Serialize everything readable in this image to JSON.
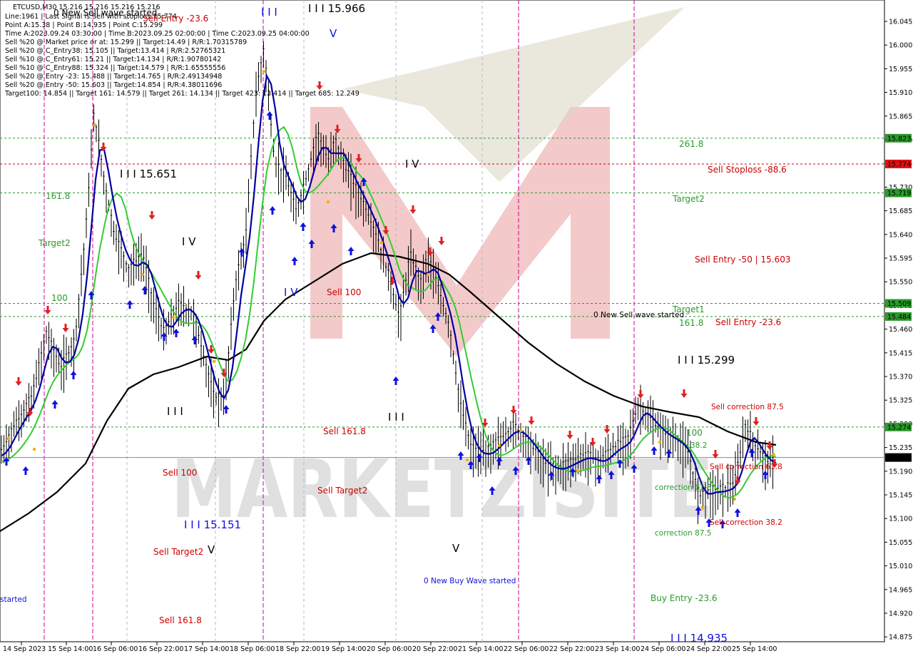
{
  "info": {
    "symbol_line": "ETCUSD,M30  15.216 15.216 15.216 15.216",
    "lines": [
      "Line:1961 | Last Signal is:Sell with stoploss:15.774",
      "Point A:15.38 | Point B:14.935 | Point C:15.299",
      "Time A:2023.09.24 03:30:00 | Time B:2023.09.25 02:00:00 | Time C:2023.09.25 04:00:00",
      "Sell %20 @ Market price or at: 15.299 || Target:14.49 | R/R:1.70315789",
      "Sell %20 @ C_Entry38: 15.105 || Target:13.414 | R/R:2.52765321",
      "Sell %10 @ C_Entry61: 15.21 || Target:14.134 | R/R:1.90780142",
      "Sell %10 @ C_Entry88: 15.324 || Target:14.579 | R/R:1.65555556",
      "Sell %20 @ Entry -23: 15.488 || Target:14.765 | R/R:2.49134948",
      "Sell %20 @ Entry -50: 15.603 || Target:14.854 | R/R:4.38011696",
      "Target100: 14.854 || Target 161: 14.579 || Target 261: 14.134 || Target 423: 13.414 || Target 685: 12.249"
    ]
  },
  "watermark": "MARKETZISITE",
  "colors": {
    "background": "#ffffff",
    "sell_red": "#e02020",
    "buy_blue": "#1010e0",
    "green_line": "#33cc33",
    "navy_line": "#0000a0",
    "black_line": "#000000",
    "level_green": "#2a9a2a",
    "level_red": "#cc0000",
    "current_price_line": "#7a8aa8"
  },
  "price_axis": {
    "ticks": [
      "16.045",
      "16.000",
      "15.955",
      "15.910",
      "15.865",
      "15.820",
      "15.775",
      "15.730",
      "15.685",
      "15.640",
      "15.595",
      "15.550",
      "15.505",
      "15.460",
      "15.415",
      "15.370",
      "15.325",
      "15.280",
      "15.235",
      "15.190",
      "15.145",
      "15.100",
      "15.055",
      "15.010",
      "14.965",
      "14.920",
      "14.875"
    ],
    "tag_labels": [
      {
        "text": "15.823",
        "kind": "green"
      },
      {
        "text": "15.774",
        "kind": "red"
      },
      {
        "text": "15.719",
        "kind": "green"
      },
      {
        "text": "15.509",
        "kind": "green"
      },
      {
        "text": "15.484",
        "kind": "green"
      },
      {
        "text": "15.274",
        "kind": "green"
      },
      {
        "text": "15.216",
        "kind": "current"
      }
    ]
  },
  "time_axis": {
    "labels": [
      "14 Sep 2023",
      "15 Sep 14:00",
      "16 Sep 06:00",
      "16 Sep 22:00",
      "17 Sep 14:00",
      "18 Sep 06:00",
      "18 Sep 22:00",
      "19 Sep 14:00",
      "20 Sep 06:00",
      "20 Sep 22:00",
      "21 Sep 14:00",
      "22 Sep 06:00",
      "22 Sep 22:00",
      "23 Sep 14:00",
      "24 Sep 06:00",
      "24 Sep 22:00",
      "25 Sep 14:00"
    ]
  },
  "annotations": [
    {
      "text": "0 New Sell wave started",
      "color": "black"
    },
    {
      "text": "Sell Entry -23.6",
      "color": "red"
    },
    {
      "text": "I I I 15.966",
      "color": "black"
    },
    {
      "text": "I I I",
      "color": "blue"
    },
    {
      "text": "V",
      "color": "blue"
    },
    {
      "text": "I I I 15.651",
      "color": "black"
    },
    {
      "text": "161.8",
      "color": "green"
    },
    {
      "text": "Target2",
      "color": "green"
    },
    {
      "text": "100",
      "color": "green"
    },
    {
      "text": "I V",
      "color": "black"
    },
    {
      "text": "I V",
      "color": "blue"
    },
    {
      "text": "Sell 100",
      "color": "red"
    },
    {
      "text": "I V",
      "color": "black"
    },
    {
      "text": "261.8",
      "color": "green"
    },
    {
      "text": "Sell Stoploss -88.6",
      "color": "red"
    },
    {
      "text": "Target2",
      "color": "green"
    },
    {
      "text": "Sell Entry -50 | 15.603",
      "color": "red"
    },
    {
      "text": "Target1",
      "color": "green"
    },
    {
      "text": "0 New Sell wave started",
      "color": "black"
    },
    {
      "text": "161.8",
      "color": "green"
    },
    {
      "text": "Sell Entry -23.6",
      "color": "red"
    },
    {
      "text": "I I I 15.299",
      "color": "black"
    },
    {
      "text": "I I I",
      "color": "black"
    },
    {
      "text": "I I I",
      "color": "black"
    },
    {
      "text": "Sell 161.8",
      "color": "red"
    },
    {
      "text": "Sell 100",
      "color": "red"
    },
    {
      "text": "Sell Target2",
      "color": "red"
    },
    {
      "text": "I I I 15.151",
      "color": "blue"
    },
    {
      "text": "Sell Target2",
      "color": "red"
    },
    {
      "text": "V",
      "color": "black"
    },
    {
      "text": "V",
      "color": "black"
    },
    {
      "text": "0 New Buy Wave started",
      "color": "blue"
    },
    {
      "text": "Sell 161.8",
      "color": "red"
    },
    {
      "text": "started",
      "color": "blue"
    },
    {
      "text": "Sell correction 87.5",
      "color": "red"
    },
    {
      "text": "100",
      "color": "green"
    },
    {
      "text": "38.2",
      "color": "green"
    },
    {
      "text": "Sell correction 61.8",
      "color": "red"
    },
    {
      "text": "correction 61.8",
      "color": "green"
    },
    {
      "text": "correction 87.5",
      "color": "green"
    },
    {
      "text": "Sell correction 38.2",
      "color": "red"
    },
    {
      "text": "Buy Entry -23.6",
      "color": "green"
    },
    {
      "text": "I I I 14.935",
      "color": "blue"
    }
  ],
  "chart_data": {
    "type": "candlestick",
    "title": "ETCUSD,M30",
    "ylim": [
      14.86,
      16.06
    ],
    "price_series_approx": [
      [
        "14 Sep 2023",
        15.22
      ],
      [
        "15 Sep 14:00",
        15.34
      ],
      [
        "16 Sep 06:00",
        15.78
      ],
      [
        "16 Sep 22:00",
        15.52
      ],
      [
        "17 Sep 14:00",
        15.32
      ],
      [
        "18 Sep 06:00",
        15.96
      ],
      [
        "18 Sep 22:00",
        15.7
      ],
      [
        "19 Sep 14:00",
        15.7
      ],
      [
        "20 Sep 06:00",
        15.47
      ],
      [
        "20 Sep 22:00",
        15.44
      ],
      [
        "21 Sep 14:00",
        15.18
      ],
      [
        "22 Sep 06:00",
        15.24
      ],
      [
        "22 Sep 22:00",
        15.2
      ],
      [
        "23 Sep 14:00",
        15.25
      ],
      [
        "24 Sep 06:00",
        15.26
      ],
      [
        "24 Sep 22:00",
        15.14
      ],
      [
        "25 Sep 14:00",
        15.22
      ]
    ],
    "horizontal_levels": [
      {
        "label": "15.823",
        "price": 15.823,
        "color": "green"
      },
      {
        "label": "Sell Stoploss -88.6",
        "price": 15.774,
        "color": "red"
      },
      {
        "label": "15.719",
        "price": 15.719,
        "color": "green"
      },
      {
        "label": "15.509",
        "price": 15.509,
        "color": "green"
      },
      {
        "label": "15.484",
        "price": 15.484,
        "color": "green"
      },
      {
        "label": "15.274",
        "price": 15.274,
        "color": "green"
      },
      {
        "label": "current",
        "price": 15.216,
        "color": "gray"
      }
    ],
    "moving_averages": [
      "black (slow)",
      "green (medium)",
      "navy (fast)"
    ]
  }
}
